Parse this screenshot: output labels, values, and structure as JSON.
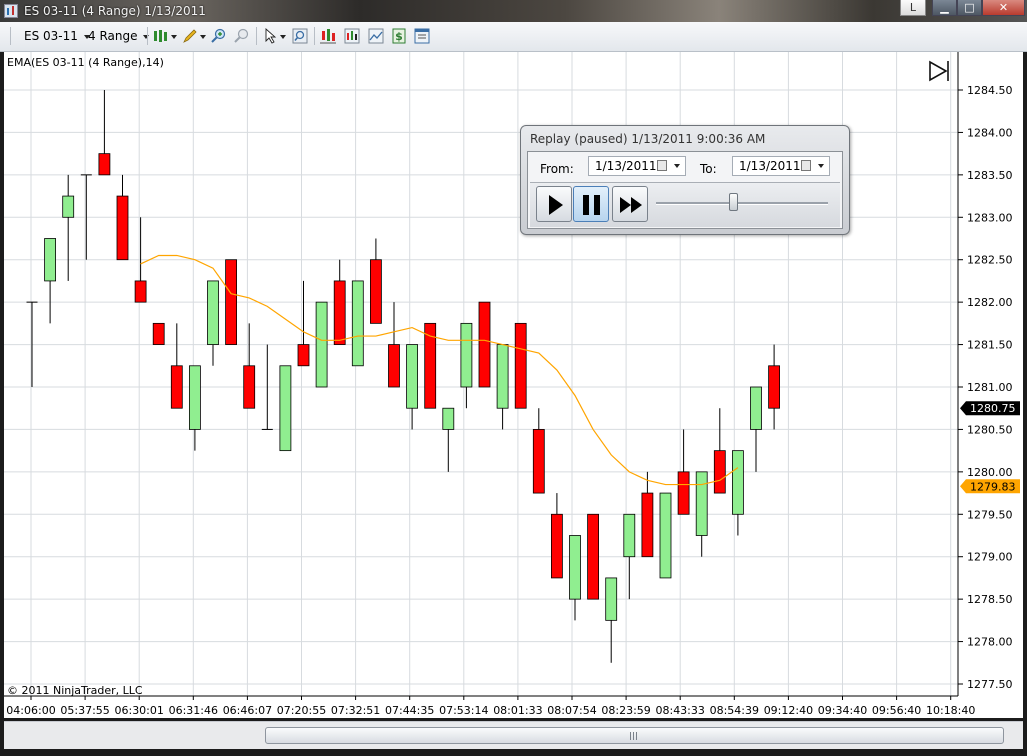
{
  "window": {
    "title": "ES 03-11 (4 Range)  1/13/2011",
    "btn_l": "L",
    "btn_min": "▁",
    "btn_max": "□",
    "btn_close": "✕"
  },
  "toolbar": {
    "instrument": "ES 03-11",
    "period": "4 Range",
    "icons": [
      "bar-type-icon",
      "pencil-icon",
      "zoom-in-icon",
      "zoom-out-icon",
      "cursor-icon",
      "magnifier-icon",
      "instrument-overlay-icon",
      "bar-chart-icon",
      "chart-icon",
      "dollar-icon",
      "properties-icon"
    ]
  },
  "indicator_label": "EMA(ES 03-11 (4 Range),14)",
  "copyright": "© 2011 NinjaTrader, LLC",
  "replay": {
    "title": "Replay (paused) 1/13/2011 9:00:36 AM",
    "from_label": "From:",
    "from_value": "1/13/2011",
    "to_label": "To:",
    "to_value": "1/13/2011",
    "speed_fraction": 0.45
  },
  "colors": {
    "up": "#90ee90",
    "down": "#ff0000",
    "ema": "#ffa500",
    "grid": "#d7dbdf",
    "last_price_bg": "#000000",
    "ema_price_bg": "#ffa500"
  },
  "chart_data": {
    "type": "candlestick",
    "y_ticks": [
      "1284.50",
      "1284.00",
      "1283.50",
      "1283.00",
      "1282.50",
      "1282.00",
      "1281.50",
      "1281.00",
      "1280.50",
      "1280.00",
      "1279.50",
      "1279.00",
      "1278.50",
      "1278.00",
      "1277.50"
    ],
    "ylim": [
      1277.5,
      1284.5
    ],
    "x_ticks": [
      "04:06:00",
      "05:37:55",
      "06:30:01",
      "06:31:46",
      "06:46:07",
      "07:20:55",
      "07:32:51",
      "07:44:35",
      "07:53:14",
      "08:01:33",
      "08:07:54",
      "08:23:59",
      "08:43:33",
      "08:54:39",
      "09:12:40",
      "09:34:40",
      "09:56:40",
      "10:18:40"
    ],
    "bars": [
      {
        "o": 1282.0,
        "h": 1282.0,
        "l": 1281.0,
        "c": 1282.0
      },
      {
        "o": 1282.25,
        "h": 1282.75,
        "l": 1281.75,
        "c": 1282.75
      },
      {
        "o": 1283.0,
        "h": 1283.5,
        "l": 1282.25,
        "c": 1283.25
      },
      {
        "o": 1283.5,
        "h": 1283.5,
        "l": 1282.5,
        "c": 1283.5
      },
      {
        "o": 1283.75,
        "h": 1284.5,
        "l": 1283.5,
        "c": 1283.5
      },
      {
        "o": 1283.25,
        "h": 1283.5,
        "l": 1282.5,
        "c": 1282.5
      },
      {
        "o": 1282.25,
        "h": 1283.0,
        "l": 1282.0,
        "c": 1282.0
      },
      {
        "o": 1281.75,
        "h": 1281.75,
        "l": 1281.5,
        "c": 1281.5
      },
      {
        "o": 1281.25,
        "h": 1281.75,
        "l": 1280.75,
        "c": 1280.75
      },
      {
        "o": 1280.5,
        "h": 1281.25,
        "l": 1280.25,
        "c": 1281.25
      },
      {
        "o": 1281.5,
        "h": 1282.25,
        "l": 1281.25,
        "c": 1282.25
      },
      {
        "o": 1282.5,
        "h": 1282.5,
        "l": 1281.5,
        "c": 1281.5
      },
      {
        "o": 1281.25,
        "h": 1281.75,
        "l": 1280.75,
        "c": 1280.75
      },
      {
        "o": 1280.5,
        "h": 1281.5,
        "l": 1280.5,
        "c": 1280.5
      },
      {
        "o": 1280.25,
        "h": 1281.25,
        "l": 1280.25,
        "c": 1281.25
      },
      {
        "o": 1281.5,
        "h": 1282.25,
        "l": 1281.25,
        "c": 1281.25
      },
      {
        "o": 1281.0,
        "h": 1282.0,
        "l": 1281.0,
        "c": 1282.0
      },
      {
        "o": 1282.25,
        "h": 1282.5,
        "l": 1281.5,
        "c": 1281.5
      },
      {
        "o": 1281.25,
        "h": 1282.25,
        "l": 1281.25,
        "c": 1282.25
      },
      {
        "o": 1282.5,
        "h": 1282.75,
        "l": 1281.75,
        "c": 1281.75
      },
      {
        "o": 1281.5,
        "h": 1282.0,
        "l": 1281.0,
        "c": 1281.0
      },
      {
        "o": 1280.75,
        "h": 1281.5,
        "l": 1280.5,
        "c": 1281.5
      },
      {
        "o": 1281.75,
        "h": 1281.75,
        "l": 1280.75,
        "c": 1280.75
      },
      {
        "o": 1280.5,
        "h": 1280.75,
        "l": 1280.0,
        "c": 1280.75
      },
      {
        "o": 1281.0,
        "h": 1281.75,
        "l": 1280.75,
        "c": 1281.75
      },
      {
        "o": 1282.0,
        "h": 1282.0,
        "l": 1281.0,
        "c": 1281.0
      },
      {
        "o": 1280.75,
        "h": 1281.5,
        "l": 1280.5,
        "c": 1281.5
      },
      {
        "o": 1281.75,
        "h": 1281.75,
        "l": 1280.75,
        "c": 1280.75
      },
      {
        "o": 1280.5,
        "h": 1280.75,
        "l": 1279.75,
        "c": 1279.75
      },
      {
        "o": 1279.5,
        "h": 1279.75,
        "l": 1278.75,
        "c": 1278.75
      },
      {
        "o": 1278.5,
        "h": 1279.25,
        "l": 1278.25,
        "c": 1279.25
      },
      {
        "o": 1279.5,
        "h": 1279.5,
        "l": 1278.5,
        "c": 1278.5
      },
      {
        "o": 1278.25,
        "h": 1278.75,
        "l": 1277.75,
        "c": 1278.75
      },
      {
        "o": 1279.0,
        "h": 1279.5,
        "l": 1278.5,
        "c": 1279.5
      },
      {
        "o": 1279.75,
        "h": 1280.0,
        "l": 1279.0,
        "c": 1279.0
      },
      {
        "o": 1278.75,
        "h": 1279.75,
        "l": 1278.75,
        "c": 1279.75
      },
      {
        "o": 1280.0,
        "h": 1280.5,
        "l": 1279.5,
        "c": 1279.5
      },
      {
        "o": 1279.25,
        "h": 1280.0,
        "l": 1279.0,
        "c": 1280.0
      },
      {
        "o": 1280.25,
        "h": 1280.75,
        "l": 1279.75,
        "c": 1279.75
      },
      {
        "o": 1279.5,
        "h": 1280.25,
        "l": 1279.25,
        "c": 1280.25
      },
      {
        "o": 1280.5,
        "h": 1281.0,
        "l": 1280.0,
        "c": 1281.0
      },
      {
        "o": 1281.25,
        "h": 1281.5,
        "l": 1280.5,
        "c": 1280.75
      }
    ],
    "ema_values": [
      1282.45,
      1282.55,
      1282.55,
      1282.5,
      1282.4,
      1282.1,
      1282.05,
      1281.95,
      1281.8,
      1281.65,
      1281.55,
      1281.55,
      1281.6,
      1281.6,
      1281.65,
      1281.7,
      1281.6,
      1281.55,
      1281.55,
      1281.55,
      1281.5,
      1281.45,
      1281.4,
      1281.2,
      1280.9,
      1280.5,
      1280.2,
      1280.0,
      1279.9,
      1279.85,
      1279.85,
      1279.85,
      1279.9,
      1280.05
    ],
    "ema_start_index": 6,
    "last_price": "1280.75",
    "ema_price": "1279.83"
  }
}
